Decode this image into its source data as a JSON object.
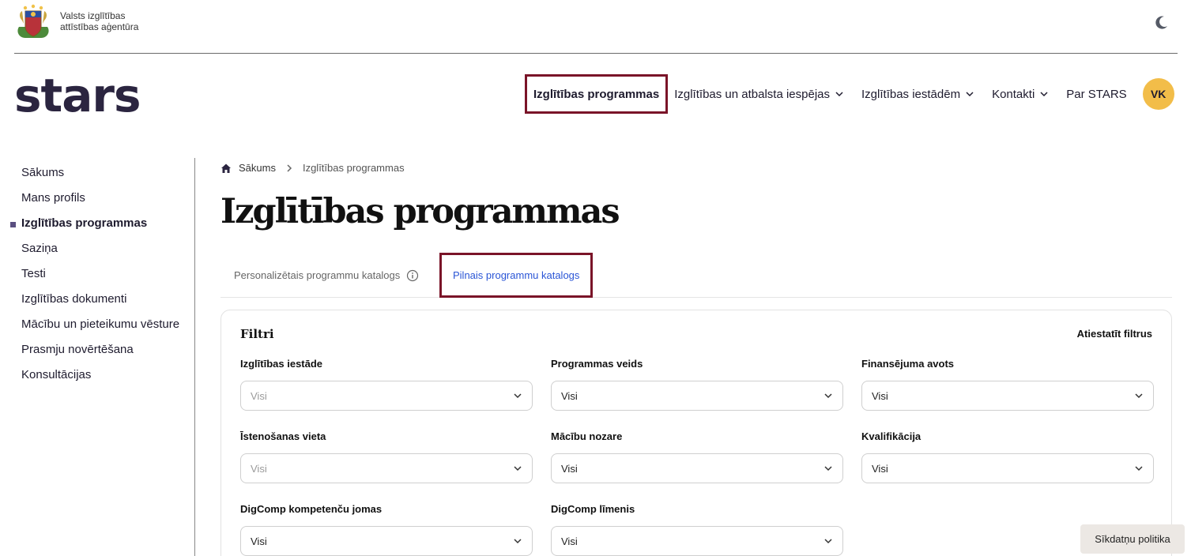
{
  "header": {
    "agency_line1": "Valsts izglītības",
    "agency_line2": "attīstības aģentūra",
    "logo_text": "stars"
  },
  "nav": {
    "items": [
      {
        "label": "Izglītības programmas"
      },
      {
        "label": "Izglītības un atbalsta iespējas"
      },
      {
        "label": "Izglītības iestādēm"
      },
      {
        "label": "Kontakti"
      },
      {
        "label": "Par STARS"
      }
    ],
    "avatar_initials": "VK"
  },
  "sidebar": {
    "items": [
      {
        "label": "Sākums"
      },
      {
        "label": "Mans profils"
      },
      {
        "label": "Izglītības programmas"
      },
      {
        "label": "Saziņa"
      },
      {
        "label": "Testi"
      },
      {
        "label": "Izglītības dokumenti"
      },
      {
        "label": "Mācību un pieteikumu vēsture"
      },
      {
        "label": "Prasmju novērtēšana"
      },
      {
        "label": "Konsultācijas"
      }
    ]
  },
  "breadcrumb": {
    "home": "Sākums",
    "current": "Izglītības programmas"
  },
  "page_title": "Izglītības programmas",
  "tabs": {
    "personalized": "Personalizētais programmu katalogs",
    "full": "Pilnais programmu katalogs"
  },
  "filters": {
    "title": "Filtri",
    "reset": "Atiestatīt filtrus",
    "fields": [
      {
        "label": "Izglītības iestāde",
        "value": "Visi"
      },
      {
        "label": "Programmas veids",
        "value": "Visi"
      },
      {
        "label": "Finansējuma avots",
        "value": "Visi"
      },
      {
        "label": "Īstenošanas vieta",
        "value": "Visi"
      },
      {
        "label": "Mācību nozare",
        "value": "Visi"
      },
      {
        "label": "Kvalifikācija",
        "value": "Visi"
      },
      {
        "label": "DigComp kompetenču jomas",
        "value": "Visi"
      },
      {
        "label": "DigComp līmenis",
        "value": "Visi"
      }
    ]
  },
  "cookie_button": "Sīkdatņu politika",
  "colors": {
    "highlight_border": "#7a1428",
    "avatar_bg": "#f2bd49",
    "active_tab_text": "#2a55d6",
    "logo": "#2b2540"
  }
}
